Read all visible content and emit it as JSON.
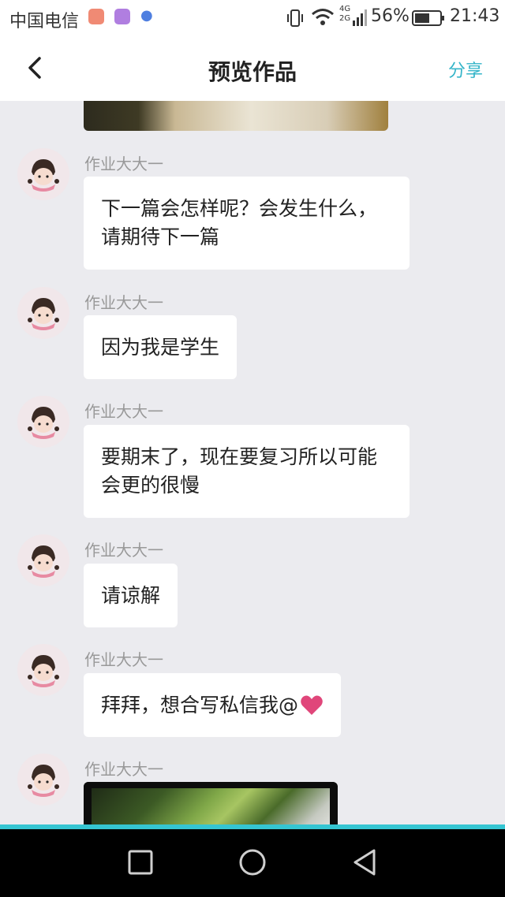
{
  "status_bar": {
    "carrier": "中国电信",
    "network": "4G 2G",
    "battery": "56%",
    "time": "21:43"
  },
  "nav": {
    "title": "预览作品",
    "share_label": "分享"
  },
  "messages": [
    {
      "author": "作业大大一",
      "text": "下一篇会怎样呢？会发生什么，请期待下一篇"
    },
    {
      "author": "作业大大一",
      "text": "因为我是学生"
    },
    {
      "author": "作业大大一",
      "text": "要期末了，现在要复习所以可能会更的很慢"
    },
    {
      "author": "作业大大一",
      "text": "请谅解"
    },
    {
      "author": "作业大大一",
      "text": "拜拜，想合写私信我@"
    },
    {
      "author": "作业大大一",
      "text": ""
    }
  ],
  "colors": {
    "accent": "#35b5c9",
    "background": "#ebebef",
    "heart": "#e0467a"
  }
}
